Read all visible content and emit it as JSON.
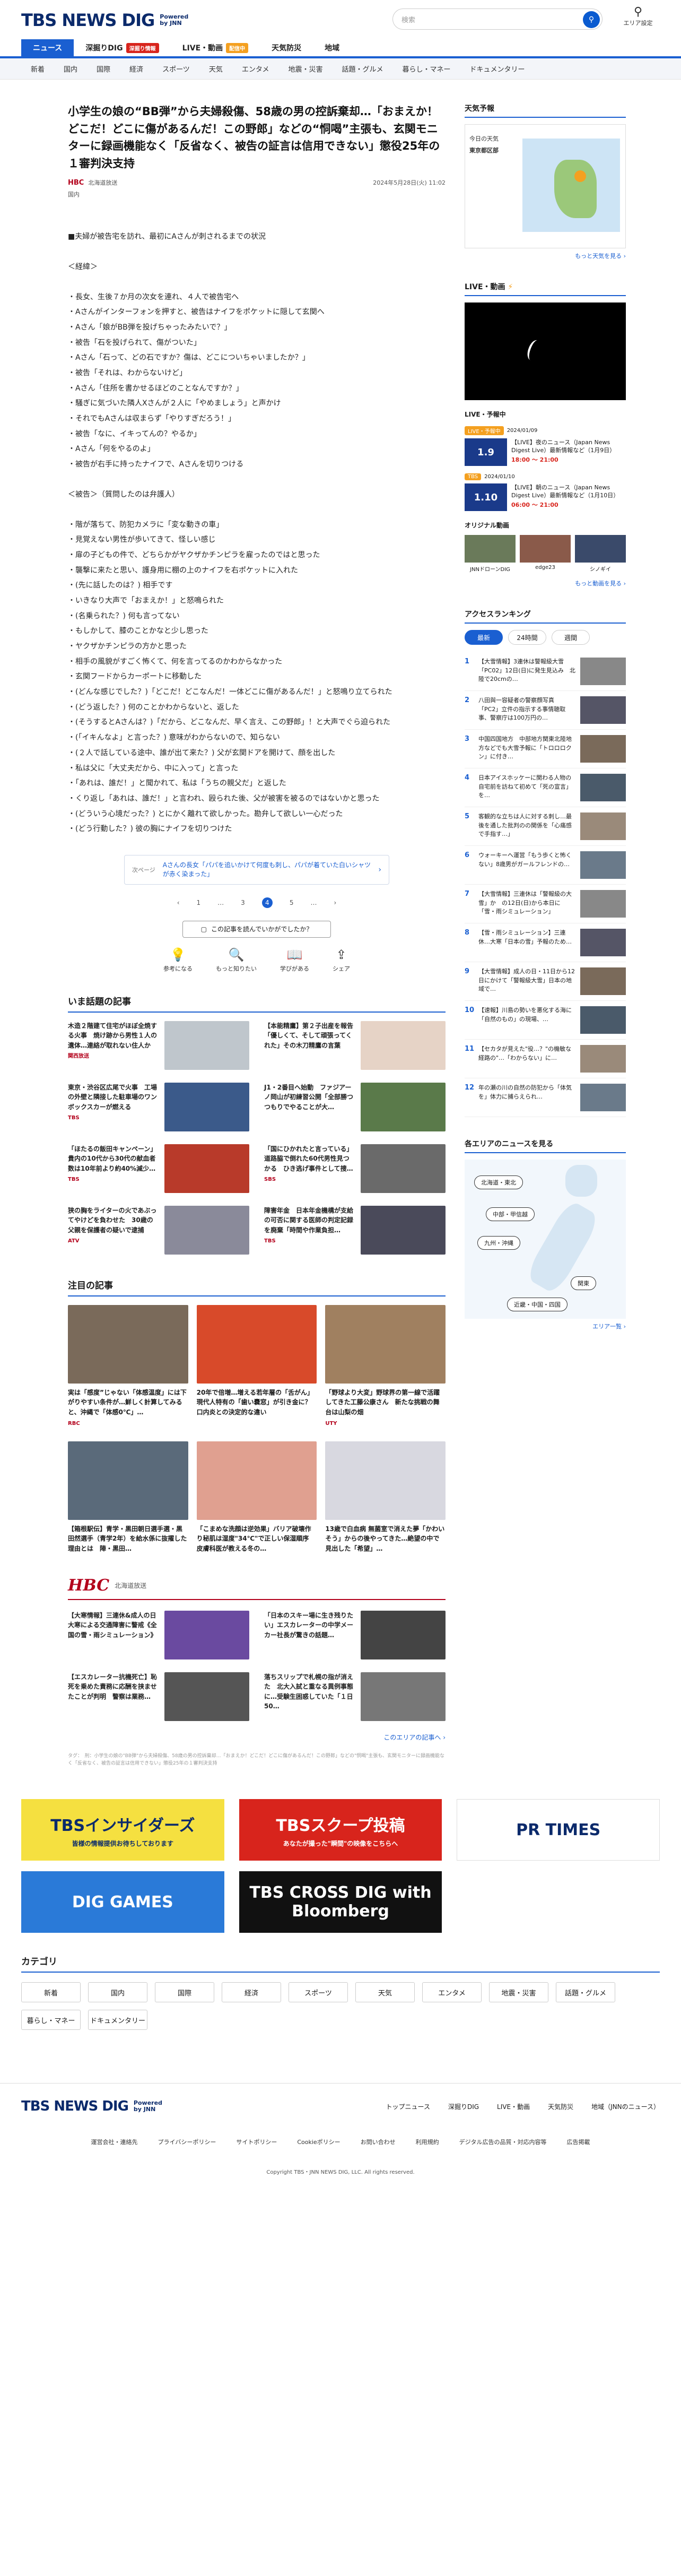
{
  "header": {
    "logo": "TBS NEWS DIG",
    "powered": "Powered by JNN",
    "search_placeholder": "検索",
    "area_label": "エリア設定"
  },
  "nav_primary": [
    {
      "label": "ニュース",
      "active": true,
      "badge": ""
    },
    {
      "label": "深掘りDIG",
      "active": false,
      "badge": "深掘り情報"
    },
    {
      "label": "LIVE・動画",
      "active": false,
      "badge": "配信中"
    },
    {
      "label": "天気防災",
      "active": false,
      "badge": ""
    },
    {
      "label": "地域",
      "active": false,
      "badge": ""
    }
  ],
  "nav_secondary": [
    "新着",
    "国内",
    "国際",
    "経済",
    "スポーツ",
    "天気",
    "エンタメ",
    "地震・災害",
    "話題・グルメ",
    "暮らし・マネー",
    "ドキュメンタリー"
  ],
  "article": {
    "title": "小学生の娘の“BB弾”から夫婦殺傷、58歳の男の控訴棄却…「おまえか！どこだ！どこに傷があるんだ！この野郎」などの“恫喝”主張も、玄関モニターに録画機能なく「反省なく、被告の証言は信用できない」懲役25年の１審判決支持",
    "source": "北海道放送",
    "source_logo": "HBC",
    "date": "2024年5月28日(火) 11:02",
    "category": "国内",
    "paragraphs": [
      "■夫婦が被告宅を訪れ、最初にAさんが刺されるまでの状況",
      "",
      "＜経緯＞",
      "",
      "・長女、生後７か月の次女を連れ、４人で被告宅へ",
      "・Aさんがインターフォンを押すと、被告はナイフをポケットに隠して玄関へ",
      "・Aさん「娘がBB弾を投げちゃったみたいで？」",
      "・被告「石を投げられて、傷がついた」",
      "・Aさん「石って、どの石ですか？傷は、どこについちゃいましたか？」",
      "・被告「それは、わからないけど」",
      "・Aさん「住所を書かせるほどのことなんですか？」",
      "・騒ぎに気づいた隣人Xさんが２人に「やめましょう」と声かけ",
      "・それでもAさんは収まらず「やりすぎだろう！」",
      "・被告「なに、イキってんの？やるか」",
      "・Aさん「何をやるのよ」",
      "・被告が右手に持ったナイフで、Aさんを切りつける",
      "",
      "＜被告＞（質問したのは弁護人）",
      "",
      "・階が落ちて、防犯カメラに「変な動きの車」",
      "・見覚えない男性が歩いてきて、怪しい感じ",
      "・扉の子どもの件で、どちらかがヤクザかチンピラを雇ったのではと思った",
      "・襲撃に来たと思い、護身用に棚の上のナイフを右ポケットに入れた",
      "・(先に話したのは？) 相手です",
      "・いきなり大声で「おまえか！」と怒鳴られた",
      "・(名乗られた？) 何も言ってない",
      "・もしかして、膝のことかなと少し思った",
      "・ヤクザかチンピラの方かと思った",
      "・相手の風貌がすごく怖くて、何を言ってるのかわからなかった",
      "・玄関フードからカーポートに移動した",
      "・(どんな感じでした？)「どこだ！どこなんだ！一体どこに傷があるんだ！」と怒鳴り立てられた",
      "・(どう返した？) 何のことかわからないと、返した",
      "・(そうするとAさんは？)「だから、どこなんだ、早く言え、この野郎」！と大声でぐら迫られた",
      "・(「イキんなよ」と言った？) 意味がわからないので、知らない",
      "・(２人で話している途中、誰が出て来た？) 父が玄関ドアを開けて、顔を出した",
      "・私は父に「大丈夫だから、中に入って」と言った",
      "・「あれは、誰だ！」と聞かれて、私は「うちの親父だ」と返した",
      "・くり返し「あれは、誰だ！」と言われ、殴られた後、父が被害を被るのではないかと思った",
      "・(どういう心境だった？) とにかく離れて欲しかった。勘弁して欲しい一心だった",
      "・(どう行動した？) 彼の胸にナイフを切りつけた"
    ],
    "next_label": "次ページ",
    "next_text": "Aさんの長女「パパを追いかけて何度も刺し、パパが着ていた白いシャツが赤く染まった」",
    "pages": [
      "1",
      "…",
      "3",
      "4",
      "5",
      "…"
    ],
    "current_page": "4",
    "question": "この記事を読んでいかがでしたか？",
    "reactions": [
      {
        "icon": "lightbulb-icon",
        "glyph": "💡",
        "label": "参考になる"
      },
      {
        "icon": "search-icon",
        "glyph": "🔍",
        "label": "もっと知りたい"
      },
      {
        "icon": "book-icon",
        "glyph": "📖",
        "label": "学びがある"
      },
      {
        "icon": "share-icon",
        "glyph": "⇪",
        "label": "シェア"
      }
    ]
  },
  "trending": {
    "title": "いま話題の記事",
    "items": [
      {
        "text": "木造２階建て住宅がほぼ全焼する火事　焼け跡から男性１人の遺体…連絡が取れない住人か",
        "source": "関西放送",
        "date": "",
        "color": "#bfc6cc"
      },
      {
        "text": "【本能精鷹】第２子出産を報告「優しくて、そして頑張ってくれた」その木刀精鷹の言葉",
        "source": "",
        "date": "",
        "color": "#e6d3c6"
      },
      {
        "text": "東京・渋谷区広尾で火事　工場の外壁と隣接した駐車場のワンボックスカーが燃える",
        "source": "TBS",
        "date": "",
        "color": "#3b5a8a"
      },
      {
        "text": "J1・2番目へ始動　ファジアーノ岡山が初練習公開「全部勝つつもりでやることが大…",
        "source": "",
        "date": "",
        "color": "#5a7a4a"
      },
      {
        "text": "「ほたるの飯田キャンペーン」貴内の10代から30代の献血者数は10年前より約40%減少…",
        "source": "TBS",
        "date": "",
        "color": "#b83a2a"
      },
      {
        "text": "「国にひかれたと言っている」道路脇で倒れた60代男性見つかる　ひき逃げ事件として捜…",
        "source": "SBS",
        "date": "",
        "color": "#6a6a6a"
      },
      {
        "text": "狭の胸をライターの火であぶってやけどを負わせた　30歳の父親を保護者の疑いで逮捕",
        "source": "ATV",
        "date": "",
        "color": "#8a8a9a"
      },
      {
        "text": "障害年金　日本年金機構が支給の可否に関する医師の判定記録を廃棄「時間や作業負担…",
        "source": "TBS",
        "date": "",
        "color": "#4a4a5a"
      }
    ]
  },
  "featured": {
    "title": "注目の記事",
    "items": [
      {
        "text": "実は「感度”じゃない「体感温度」には下がりやすい条件が…鮮しく計算してみると、沖縄で「体感0℃」…",
        "source": "RBC",
        "date": "",
        "color": "#7a6a5a"
      },
      {
        "text": "20年で倍増…増える若年層の「舌がん」現代人特有の「歯い嚢窓」が引き金に？ 口内炎との決定的な違い",
        "source": "",
        "date": "",
        "color": "#d84a2a"
      },
      {
        "text": "「野球より大変」野球界の第一線で活躍してきた工藤公康さん　新たな挑戦の舞台は山梨の畑",
        "source": "UTY",
        "date": "",
        "color": "#a08060"
      },
      {
        "text": "【箱根駅伝】青学・黒田朝日選手選・黒田然選手（青学2年）を給水係に抜擢した理由とは　陣・黒田…",
        "source": "",
        "date": "",
        "color": "#5a6a7a"
      },
      {
        "text": "「こまめな洗顔は逆効果」バリア破壊作り秘肌は湿度\"34℃\"で正しい保湿順序　皮膚科医が教える冬の…",
        "source": "",
        "date": "",
        "color": "#e0a090"
      },
      {
        "text": "13歳で白血病 無菌室で消えた夢「かわいそう」からの後やってきた…絶望の中で見出した「希望」…",
        "source": "",
        "date": "",
        "color": "#d8d8e0"
      }
    ]
  },
  "hbc": {
    "logo": "HBC",
    "name": "北海道放送",
    "items": [
      {
        "text": "【大寒情報】三連休&成人の日大寒による交通障害に警戒《全国の雪・雨シミュレーション》",
        "source": "",
        "date": "",
        "color": "#6a4aa0"
      },
      {
        "text": "「日本のスキー場に生き残りたい」エスカレーターの中学メーカー社長が驚きの話題…",
        "source": "",
        "date": "",
        "color": "#444"
      },
      {
        "text": "【エスカレーター抗機死亡】恥死を乗めた責務に応酬を挟ませたことが判明　警察は業務…",
        "source": "",
        "date": "",
        "color": "#555"
      },
      {
        "text": "落ちスリップで札幌の指が消えた　北大入試と重なる異例事態に…受験生困惑していた「１日50…",
        "source": "",
        "date": "",
        "color": "#777"
      }
    ],
    "more": "このエリアの記事へ ›"
  },
  "tags_line": "タグ：　刑：小学生の娘の\"BB弾\"から夫婦殺傷、58歳の男の控訴棄却…「おまえか！どこだ！どこに傷があるんだ！この野郎」などの\"恫喝\"主張も、玄関モニターに録画機能なく「反省なく、被告の証言は信用できない」懲役25年の１審判決支持",
  "sidebar": {
    "weather": {
      "title": "天気予報",
      "today": "今日の天気",
      "region": "東京都区部",
      "more": "もっと天気を見る ›"
    },
    "live": {
      "title": "LIVE・動画",
      "more": "もっと動画を見る ›"
    },
    "live_items": [
      {
        "tag": "LIVE・予報中",
        "tag_time": "2024/01/09",
        "date": "1.9",
        "text": "【LIVE】夜のニュース（Japan News Digest Live）最新情報など（1月9日）",
        "time": "18:00 〜 21:00"
      },
      {
        "tag": "TBS",
        "tag_time": "2024/01/10",
        "date": "1.10",
        "text": "【LIVE】朝のニュース（Japan News Digest Live）最新情報など（1月10日）",
        "time": "06:00 〜 21:00"
      }
    ],
    "originals": {
      "title": "オリジナル動画",
      "items": [
        "JNNドローンDIG",
        "edge23",
        "シノギイ"
      ]
    },
    "ranking": {
      "title": "アクセスランキング",
      "tabs": [
        "最新",
        "24時間",
        "週間"
      ],
      "active": "最新",
      "items": [
        "【大雪情報】3連休は警報級大雪「PC02」12日(日)に発生見込み　北陸で20cmの…",
        "八田與一容疑者の警察顔写真　「PC2」立件の指示する事情聴取事、警察庁は100万円の…",
        "中国四国地方　中部地方関東北陸地方などでも大雪予報に「トロロロクン」に付き…",
        "日本アイスホッケーに関わる人物の自宅前を訪ねて初めて「死の宣言」を…",
        "客観的な立ちは人に対する刺し…最後を通した批判のの関係を「心痛感で手指す…」",
        "ウォーキーへ運営「もう歩くと怖くない」8歳男がガールフレンドの…",
        "【大雪情報】三連休は「警報級の大雪」か　の12日(日)から本日に「雪・雨シミュレーション」",
        "【雪・雨シミュレーション】三連休…大寒「日本の雪」予報のため…",
        "【大雪情報】成人の日・11日から12日にかけて「警報級大雪」日本の地域で…",
        "【速報】川島の勢いを悪化する海に「自然のもの」の現場、…",
        "【セカタが見えた\"役…？\"の機敏な経路の\"…「わからない」に…",
        "年の瀬の川の自然の防犯から「体気を」体力に捕らえられ…"
      ]
    },
    "area_map": {
      "title": "各エリアのニュースを見る",
      "regions": [
        "北海道・東北",
        "中部・甲信越",
        "九州・沖縄",
        "関東",
        "近畿・中国・四国"
      ],
      "more": "エリア一覧 ›"
    }
  },
  "banners": [
    {
      "label": "TBSインサイダーズ",
      "sub": "皆様の情報提供お待ちしております",
      "color": "#f5e040",
      "fg": "#0b2a6b"
    },
    {
      "label": "TBSスクープ投稿",
      "sub": "あなたが撮った\"瞬間\"の映像をこちらへ",
      "color": "#d8241c",
      "fg": "#ffffff"
    },
    {
      "label": "PR TIMES",
      "sub": "",
      "color": "#ffffff",
      "fg": "#0b2a6b"
    },
    {
      "label": "DIG GAMES",
      "sub": "",
      "color": "#2a7ad8",
      "fg": "#ffffff"
    },
    {
      "label": "TBS CROSS DIG with Bloomberg",
      "sub": "",
      "color": "#111111",
      "fg": "#ffffff"
    }
  ],
  "categories": {
    "title": "カテゴリ",
    "items": [
      "新着",
      "国内",
      "国際",
      "経済",
      "スポーツ",
      "天気",
      "エンタメ",
      "地震・災害",
      "話題・グルメ",
      "暮らし・マネー",
      "ドキュメンタリー"
    ]
  },
  "footer": {
    "links": [
      "トップニュース",
      "深掘りDIG",
      "LIVE・動画",
      "天気防災",
      "地域（JNNのニュース）"
    ],
    "sub_links": [
      "運営会社・連絡先",
      "プライバシーポリシー",
      "サイトポリシー",
      "Cookieポリシー",
      "お問い合わせ",
      "利用規約",
      "デジタル広告の品質・対応内容等",
      "広告掲載"
    ],
    "copyright": "Copyright TBS・JNN NEWS DIG, LLC. All rights reserved."
  },
  "colors": {
    "brand": "#0b2a6b",
    "accent": "#1a5fd1",
    "hbc_red": "#b3001b"
  }
}
